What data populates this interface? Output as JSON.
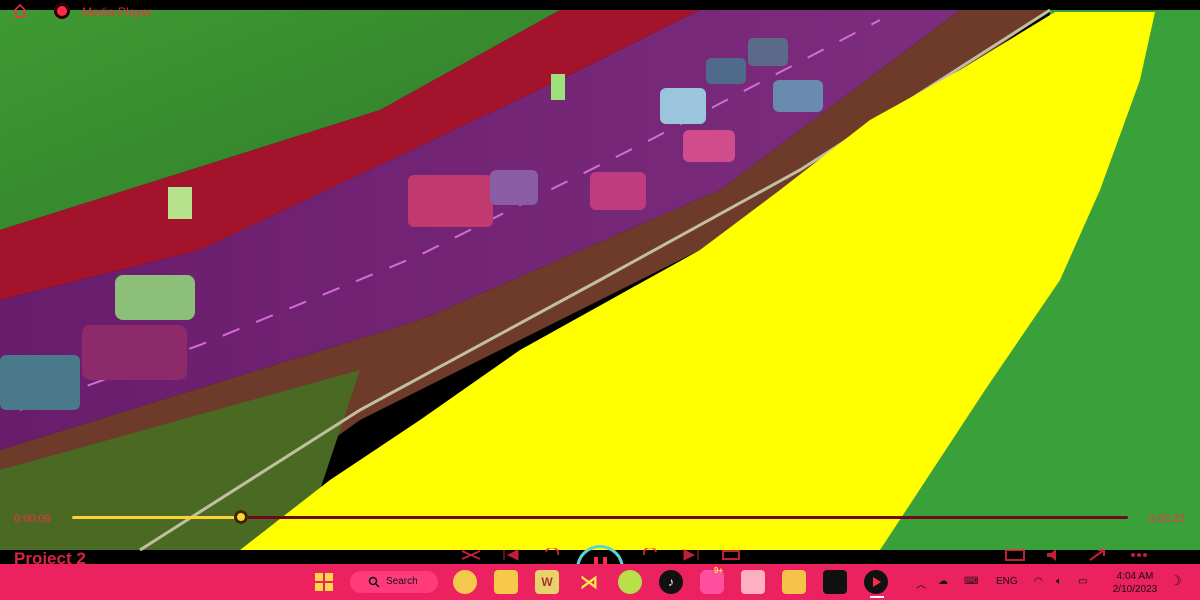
{
  "window": {
    "title": "Media Player",
    "home_icon": "home-icon",
    "app_icon": "media-player-icon"
  },
  "playback": {
    "elapsed": "0:00:09",
    "total": "0:00:22",
    "progress": 0.16,
    "state": "playing"
  },
  "project": {
    "title": "Project 2"
  },
  "taskbar": {
    "search_label": "Search",
    "pinned": [
      {
        "name": "chrome-icon",
        "badge": ""
      },
      {
        "name": "file-explorer-icon"
      },
      {
        "name": "word-icon"
      },
      {
        "name": "visual-studio-code-icon"
      },
      {
        "name": "spotify-icon"
      },
      {
        "name": "tiktok-icon"
      },
      {
        "name": "discord-icon",
        "badge": "9+"
      },
      {
        "name": "teams-icon"
      },
      {
        "name": "game-icon"
      },
      {
        "name": "terminal-icon"
      },
      {
        "name": "media-player-icon",
        "active": true
      }
    ],
    "tray": {
      "language": "ENG",
      "time": "4:04 AM",
      "date": "2/10/2023"
    }
  },
  "colors": {
    "accent": "#ff2b4a",
    "taskbar": "#ec215f",
    "seek_fill": "#ffd233",
    "overlay": "#ffff00"
  }
}
